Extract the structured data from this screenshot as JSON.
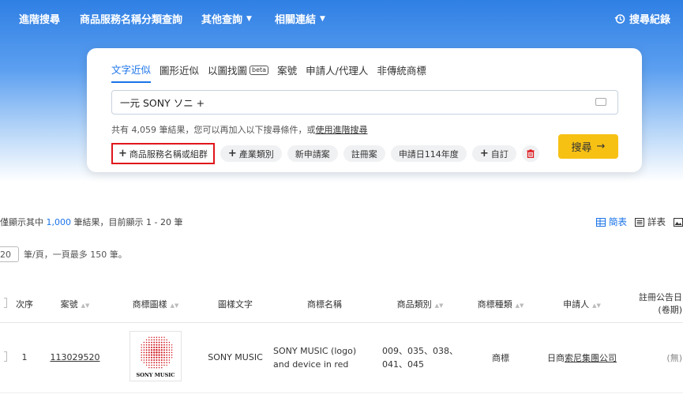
{
  "nav": {
    "items": [
      {
        "label": "進階搜尋",
        "dropdown": false
      },
      {
        "label": "商品服務名稱分類查詢",
        "dropdown": false
      },
      {
        "label": "其他查詢",
        "dropdown": true
      },
      {
        "label": "相關連結",
        "dropdown": true
      }
    ],
    "history": "搜尋紀錄"
  },
  "search": {
    "tabs": [
      "文字近似",
      "圖形近似",
      "以圖找圖",
      "案號",
      "申請人/代理人",
      "非傳統商標"
    ],
    "beta": "beta",
    "query": "一元 SONY ソニ +",
    "summary": "共有 4,059 筆結果，您可以再加入以下搜尋條件，或",
    "summary_link": "使用進階搜尋",
    "chips": [
      "商品服務名稱或組群",
      "產業類別",
      "新申請案",
      "註冊案",
      "申請日114年度",
      "自訂"
    ],
    "button": "搜尋",
    "button_arrow": "→"
  },
  "results": {
    "prefix": "僅顯示其中",
    "count": "1,000",
    "suffix": "筆結果，目前顯示 1 - 20 筆",
    "views": [
      "簡表",
      "詳表"
    ],
    "per_page": "20",
    "per_page_text": "筆/頁，一頁最多 150 筆。"
  },
  "table": {
    "headers": [
      "次序",
      "案號",
      "商標圖樣",
      "圖樣文字",
      "商標名稱",
      "商品類別",
      "商標種類",
      "申請人",
      "註冊公告日",
      "(卷期)"
    ],
    "row": {
      "index": "1",
      "case_no": "113029520",
      "logo_text": "SONY MUSIC",
      "image_text": "SONY MUSIC",
      "name_line1": "SONY MUSIC (logo)",
      "name_line2": "and device in red",
      "classes_line1": "009、035、038、",
      "classes_line2": "041、045",
      "type": "商標",
      "applicant_prefix": "日商",
      "applicant_link": "索尼集團公司",
      "reg_date": "(無)"
    }
  },
  "colors": {
    "accent": "#1a73e8",
    "button": "#f7c114",
    "highlight": "#e0161b",
    "logo_red": "#d0141c"
  }
}
